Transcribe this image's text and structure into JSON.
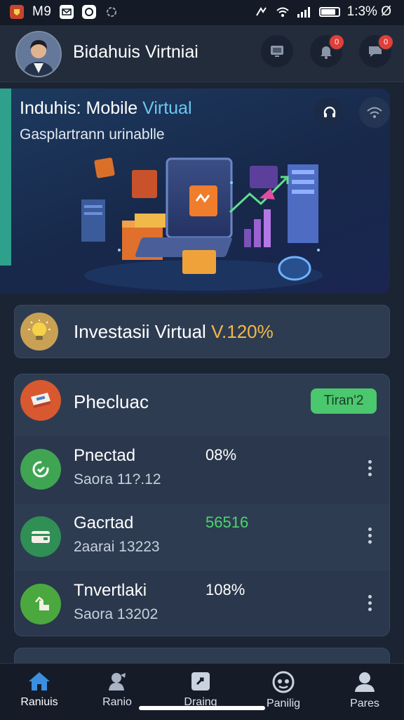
{
  "status_bar": {
    "left_text": "M9",
    "time": "1:3% Ø",
    "battery_level": 0.85
  },
  "header": {
    "title": "Bidahuis Virtniai",
    "notification_badge": "0",
    "message_badge": "0"
  },
  "hero": {
    "title_main": "Induhis: Mobile",
    "title_accent": "Virtual",
    "subtitle": "Gasplartrann urinablle"
  },
  "banner": {
    "text": "Investasii Virtual",
    "highlight": "V.120%"
  },
  "card": {
    "title": "Phecluac",
    "pill_label": "Tiran'2",
    "rows": [
      {
        "name": "Pnectad",
        "sub": "Saora 11?.12",
        "value": "08%",
        "value_color": "#ffffff",
        "icon_color": "#3fa553"
      },
      {
        "name": "Gacrtad",
        "sub": "2aarai 13223",
        "value": "56516",
        "value_color": "#4bd56c",
        "icon_color": "#2f8f55"
      },
      {
        "name": "Tnvertlaki",
        "sub": "Saora 13202",
        "value": "108%",
        "value_color": "#ffffff",
        "icon_color": "#4ba83e"
      }
    ]
  },
  "bottom_nav": {
    "items": [
      {
        "label": "Raniuis",
        "icon": "home-icon"
      },
      {
        "label": "Ranio",
        "icon": "user-icon"
      },
      {
        "label": "Draing",
        "icon": "card-icon"
      },
      {
        "label": "Panilig",
        "icon": "face-icon"
      },
      {
        "label": "Pares",
        "icon": "person-icon"
      }
    ]
  },
  "colors": {
    "background": "#1b2433",
    "card": "#2e3c52",
    "accent_green": "#4bc76e",
    "accent_blue": "#6cc8f2",
    "accent_gold": "#f1b94a",
    "nav_active": "#3b8fe0"
  }
}
